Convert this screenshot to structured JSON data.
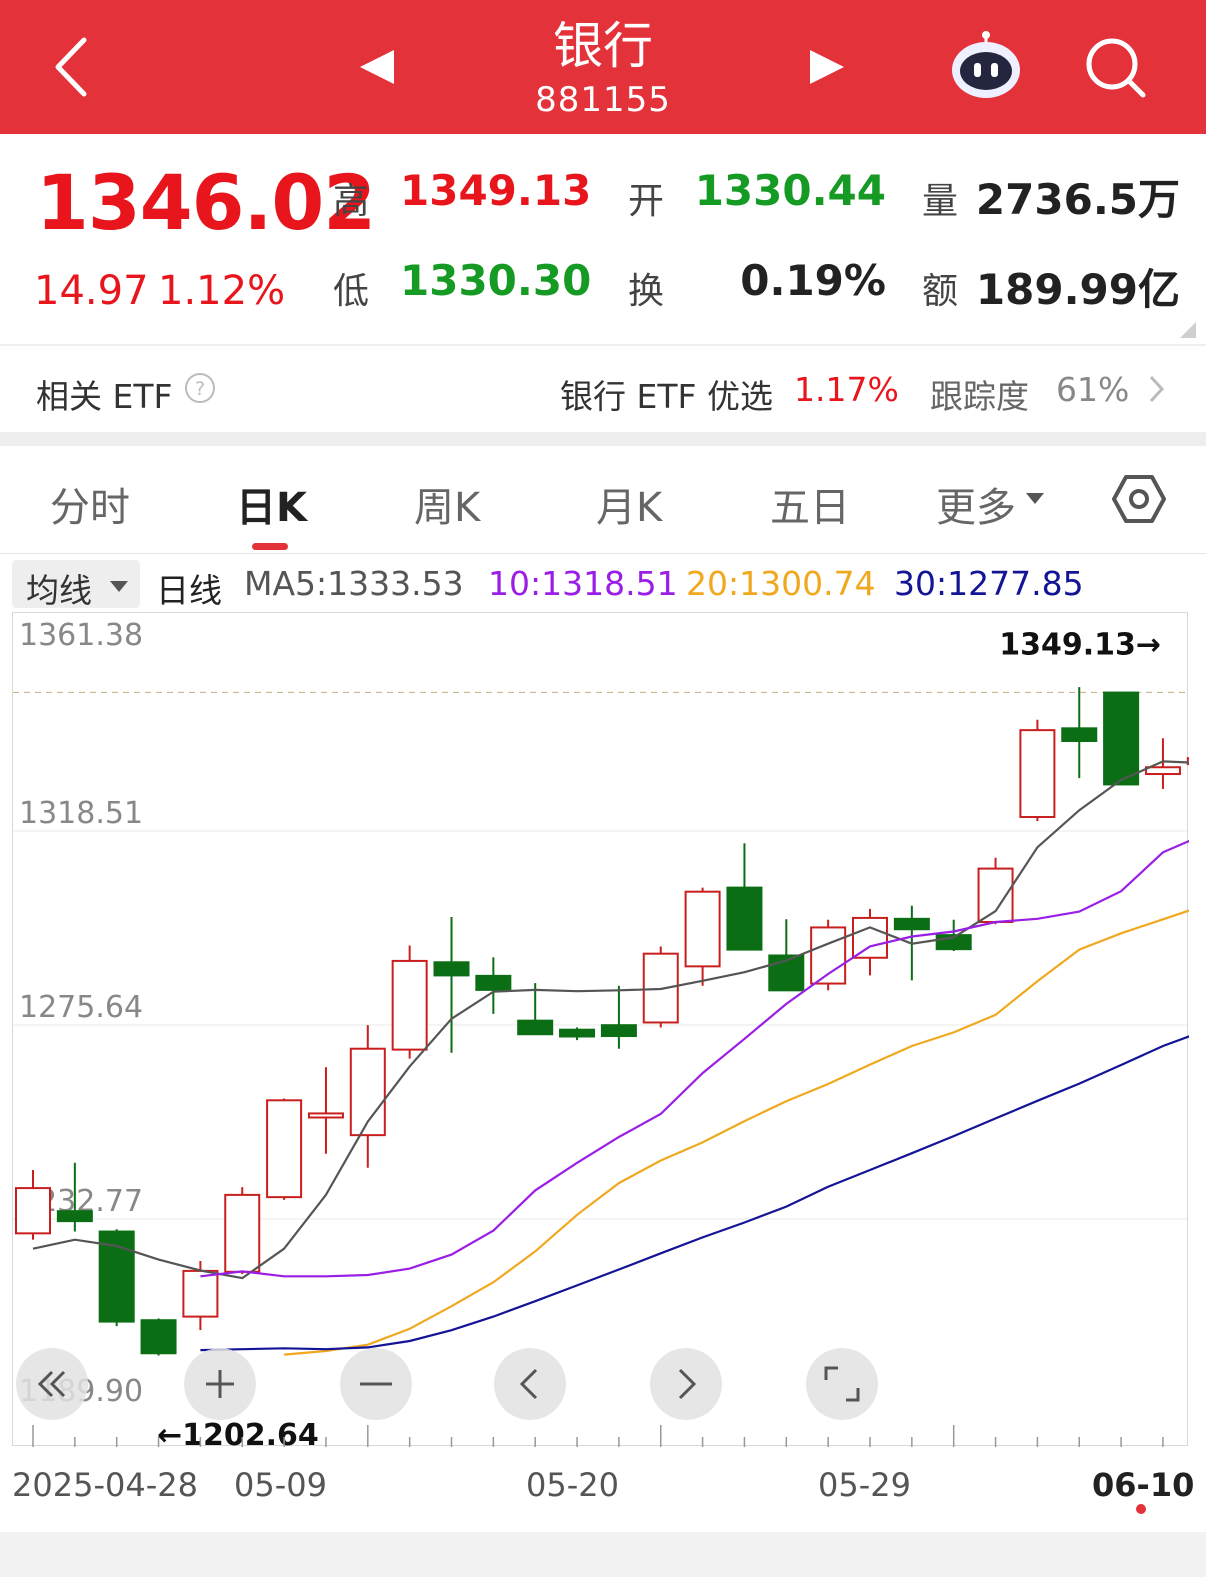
{
  "header": {
    "title": "银行",
    "code": "881155"
  },
  "quote": {
    "price": "1346.02",
    "change": "14.97",
    "change_pct": "1.12%",
    "high_label": "高",
    "high": "1349.13",
    "open_label": "开",
    "open": "1330.44",
    "volume_label": "量",
    "volume": "2736.5万",
    "low_label": "低",
    "low": "1330.30",
    "turnover_label": "换",
    "turnover": "0.19%",
    "amount_label": "额",
    "amount": "189.99亿"
  },
  "etf": {
    "label": "相关 ETF",
    "name": "银行 ETF 优选",
    "pct": "1.17%",
    "track_label": "跟踪度",
    "track_value": "61%"
  },
  "tabs": [
    "分时",
    "日K",
    "周K",
    "月K",
    "五日",
    "更多"
  ],
  "active_tab": 1,
  "ma": {
    "select_label": "均线",
    "period_label": "日线",
    "ma5": "MA5:1333.53",
    "ma10": "10:1318.51",
    "ma20": "20:1300.74",
    "ma30": "30:1277.85"
  },
  "colors": {
    "header_bg": "#e4323a",
    "up": "#e8161c",
    "down": "#159a24",
    "candle_up": "#c81e1e",
    "candle_down": "#0b6e14",
    "ma5": "#555555",
    "ma10": "#9b1ee6",
    "ma20": "#f0a81e",
    "ma30": "#141496"
  },
  "icons": {
    "back": "chevron-left-icon",
    "prev": "triangle-left-icon",
    "next": "triangle-right-icon",
    "assistant": "robot-icon",
    "search": "search-icon",
    "help": "question-circle-icon",
    "settings": "hexagon-settings-icon"
  },
  "chart_data": {
    "type": "candlestick",
    "y_ticks": [
      "1361.38",
      "1318.51",
      "1275.64",
      "1232.77",
      "1189.90"
    ],
    "ylim": [
      1189.9,
      1361.38
    ],
    "max_label": "1349.13→",
    "min_label": "←1202.64",
    "x_labels": [
      "2025-04-28",
      "05-09",
      "05-20",
      "05-29",
      "06-10"
    ],
    "candles": [
      {
        "o": 1229.6,
        "h": 1243.6,
        "l": 1228.2,
        "c": 1239.6
      },
      {
        "o": 1234.5,
        "h": 1245.2,
        "l": 1230.0,
        "c": 1232.3
      },
      {
        "o": 1230.0,
        "h": 1230.5,
        "l": 1209.1,
        "c": 1210.1
      },
      {
        "o": 1210.4,
        "h": 1210.8,
        "l": 1202.6,
        "c": 1203.1
      },
      {
        "o": 1211.2,
        "h": 1223.5,
        "l": 1208.2,
        "c": 1221.3
      },
      {
        "o": 1221.1,
        "h": 1239.8,
        "l": 1220.6,
        "c": 1238.1
      },
      {
        "o": 1237.6,
        "h": 1259.4,
        "l": 1237.0,
        "c": 1259.0
      },
      {
        "o": 1255.2,
        "h": 1266.3,
        "l": 1247.2,
        "c": 1256.1
      },
      {
        "o": 1251.3,
        "h": 1275.6,
        "l": 1244.1,
        "c": 1270.4
      },
      {
        "o": 1270.2,
        "h": 1293.2,
        "l": 1268.2,
        "c": 1289.8
      },
      {
        "o": 1289.5,
        "h": 1299.5,
        "l": 1269.5,
        "c": 1286.6
      },
      {
        "o": 1286.5,
        "h": 1290.6,
        "l": 1278.1,
        "c": 1283.4
      },
      {
        "o": 1276.6,
        "h": 1284.9,
        "l": 1274.3,
        "c": 1273.6
      },
      {
        "o": 1274.6,
        "h": 1275.1,
        "l": 1272.3,
        "c": 1273.1
      },
      {
        "o": 1275.6,
        "h": 1284.3,
        "l": 1270.4,
        "c": 1273.2
      },
      {
        "o": 1276.2,
        "h": 1293.0,
        "l": 1275.1,
        "c": 1291.4
      },
      {
        "o": 1288.6,
        "h": 1306.0,
        "l": 1284.3,
        "c": 1305.1
      },
      {
        "o": 1306.0,
        "h": 1315.8,
        "l": 1293.6,
        "c": 1292.3
      },
      {
        "o": 1291.0,
        "h": 1299.0,
        "l": 1283.3,
        "c": 1283.3
      },
      {
        "o": 1284.8,
        "h": 1298.9,
        "l": 1283.3,
        "c": 1297.2
      },
      {
        "o": 1290.5,
        "h": 1301.3,
        "l": 1286.6,
        "c": 1299.3
      },
      {
        "o": 1299.1,
        "h": 1302.0,
        "l": 1285.5,
        "c": 1296.8
      },
      {
        "o": 1295.5,
        "h": 1298.9,
        "l": 1292.0,
        "c": 1292.4
      },
      {
        "o": 1298.4,
        "h": 1312.6,
        "l": 1297.9,
        "c": 1310.2
      },
      {
        "o": 1321.6,
        "h": 1343.1,
        "l": 1320.7,
        "c": 1340.8
      },
      {
        "o": 1341.2,
        "h": 1350.3,
        "l": 1330.2,
        "c": 1338.4
      },
      {
        "o": 1349.1,
        "h": 1349.1,
        "l": 1328.9,
        "c": 1328.8
      },
      {
        "o": 1331.1,
        "h": 1339.0,
        "l": 1327.8,
        "c": 1332.6
      },
      {
        "o": 1333.3,
        "h": 1335.6,
        "l": 1318.9,
        "c": 1334.6
      },
      {
        "o": 1333.6,
        "h": 1349.1,
        "l": 1333.6,
        "c": 1346.0
      }
    ],
    "ma_series": [
      {
        "name": "MA5",
        "values": [
          1226.2,
          1228.2,
          1226.8,
          1223.8,
          1221.4,
          1219.7,
          1226.2,
          1238.1,
          1254.3,
          1266.5,
          1277.0,
          1283.0,
          1283.4,
          1283.1,
          1283.3,
          1283.6,
          1285.4,
          1287.3,
          1289.9,
          1293.6,
          1297.2,
          1293.6,
          1295.0,
          1300.8,
          1314.9,
          1323.1,
          1329.8,
          1333.9,
          1333.5,
          1333.5
        ]
      },
      {
        "name": "10",
        "values": [
          1220.1,
          1221.2,
          1220.1,
          1220.1,
          1220.4,
          1221.8,
          1224.9,
          1230.2,
          1239.1,
          1245.2,
          1250.9,
          1256.0,
          1265.0,
          1272.6,
          1280.3,
          1286.9,
          1293.0,
          1295.2,
          1296.3,
          1298.4,
          1299.1,
          1300.7,
          1305.2,
          1313.8,
          1317.8,
          1318.5
        ]
      },
      {
        "name": "20",
        "values": [
          1202.8,
          1203.6,
          1205.0,
          1208.5,
          1213.5,
          1218.8,
          1225.6,
          1233.7,
          1240.7,
          1245.7,
          1249.7,
          1254.4,
          1258.8,
          1262.6,
          1266.9,
          1271.0,
          1274.0,
          1277.9,
          1285.3,
          1292.3,
          1295.9,
          1299.0,
          1302.1,
          1306.2
        ]
      },
      {
        "name": "30",
        "values": [
          1203.8,
          1204.0,
          1204.2,
          1204.0,
          1204.4,
          1205.8,
          1208.2,
          1211.2,
          1214.6,
          1218.1,
          1221.6,
          1225.2,
          1228.7,
          1232.0,
          1235.5,
          1239.9,
          1243.6,
          1247.3,
          1251.1,
          1255.0,
          1258.9,
          1262.7,
          1266.8,
          1271.0,
          1274.4,
          1277.9
        ]
      }
    ]
  }
}
